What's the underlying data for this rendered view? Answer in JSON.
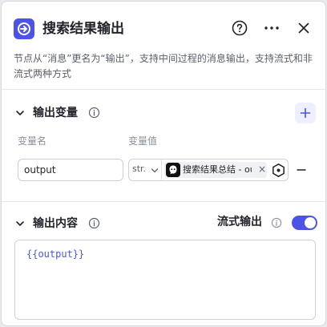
{
  "node": {
    "title": "搜索结果输出",
    "icon": "node-output-icon",
    "accent": "#4d53e8",
    "description": "节点从“消息”更名为“输出”，支持中间过程的消息输出，支持流式和非流式两种方式"
  },
  "header_actions": {
    "help_icon": "question-circle-icon",
    "more_icon": "more-dots-icon",
    "close_icon": "close-icon"
  },
  "output_vars": {
    "title": "输出变量",
    "add_icon": "plus-icon",
    "col_name": "变量名",
    "col_value": "变量值",
    "rows": [
      {
        "name": "output",
        "type": "str.",
        "ref_label": "搜索结果总结 - output",
        "ref_icon": "bot-avatar-icon"
      }
    ]
  },
  "output_content": {
    "title": "输出内容",
    "streaming_label": "流式输出",
    "streaming_on": true,
    "template": "{{output}}"
  }
}
